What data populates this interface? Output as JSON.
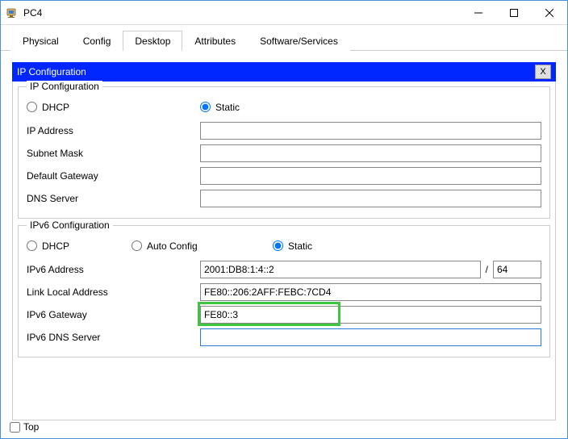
{
  "window": {
    "title": "PC4"
  },
  "tabs": {
    "physical": "Physical",
    "config": "Config",
    "desktop": "Desktop",
    "attributes": "Attributes",
    "software": "Software/Services"
  },
  "panel": {
    "header": "IP Configuration",
    "close": "X"
  },
  "ipv4": {
    "legend": "IP Configuration",
    "dhcp_label": "DHCP",
    "static_label": "Static",
    "ip_label": "IP Address",
    "ip_value": "",
    "mask_label": "Subnet Mask",
    "mask_value": "",
    "gateway_label": "Default Gateway",
    "gateway_value": "",
    "dns_label": "DNS Server",
    "dns_value": ""
  },
  "ipv6": {
    "legend": "IPv6 Configuration",
    "dhcp_label": "DHCP",
    "auto_label": "Auto Config",
    "static_label": "Static",
    "addr_label": "IPv6 Address",
    "addr_value": "2001:DB8:1:4::2",
    "slash": "/",
    "prefix_value": "64",
    "linklocal_label": "Link Local Address",
    "linklocal_value": "FE80::206:2AFF:FEBC:7CD4",
    "gateway_label": "IPv6 Gateway",
    "gateway_value": "FE80::3",
    "dns_label": "IPv6 DNS Server",
    "dns_value": ""
  },
  "footer": {
    "top_label": "Top"
  }
}
